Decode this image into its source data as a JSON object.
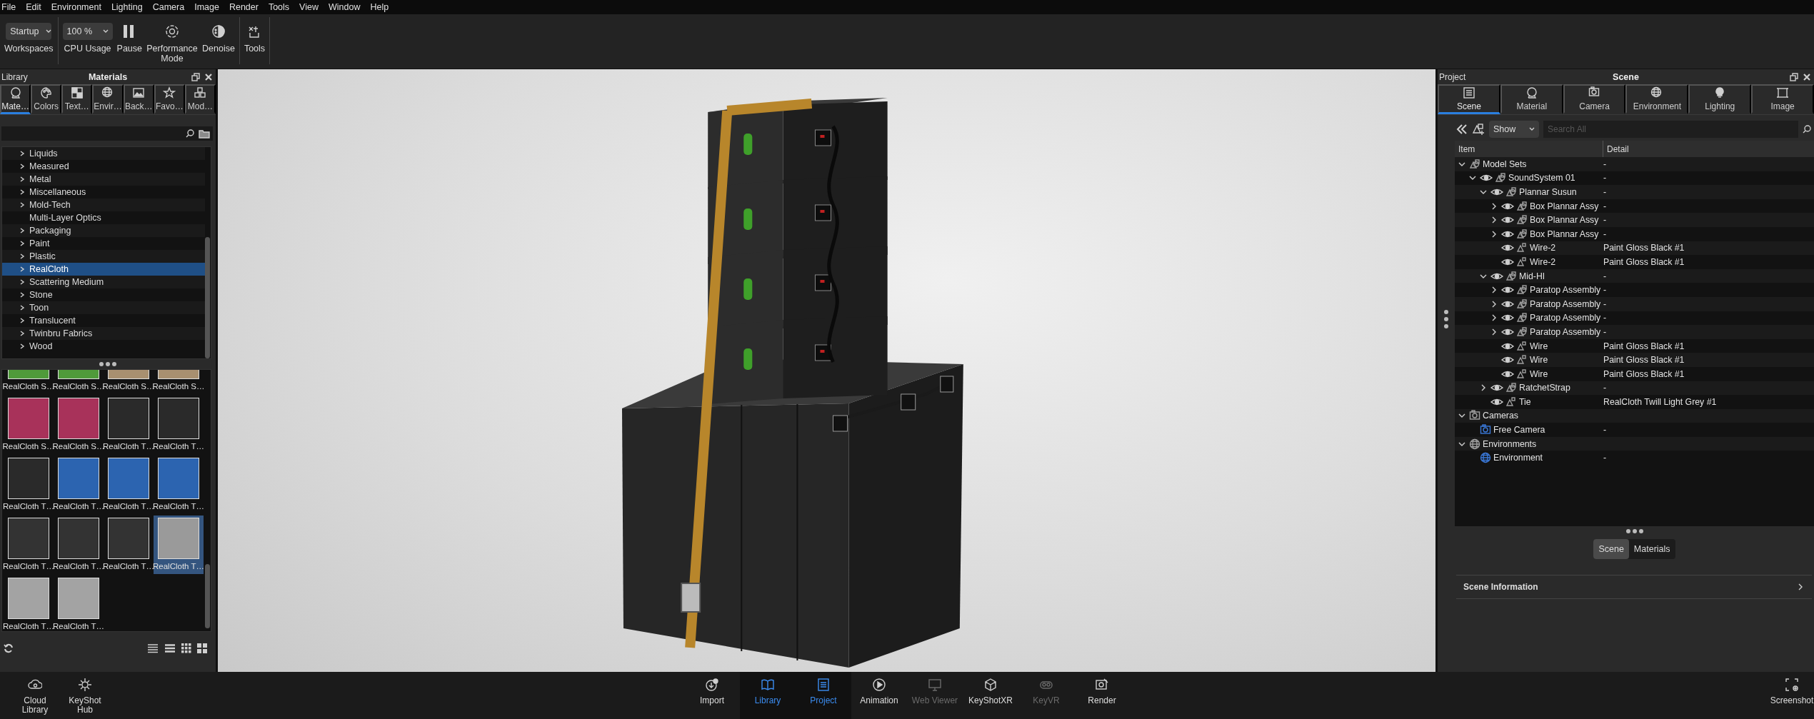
{
  "menu": [
    "File",
    "Edit",
    "Environment",
    "Lighting",
    "Camera",
    "Image",
    "Render",
    "Tools",
    "View",
    "Window",
    "Help"
  ],
  "toolbar": {
    "groups": [
      [
        {
          "kind": "dropdown",
          "value": "Startup",
          "label": "Workspaces"
        }
      ],
      [
        {
          "kind": "dropdown",
          "value": "100 %",
          "label": "CPU Usage"
        },
        {
          "kind": "button",
          "label": "Pause"
        },
        {
          "kind": "button",
          "label": "Performance Mode"
        },
        {
          "kind": "button",
          "label": "Denoise"
        }
      ],
      [
        {
          "kind": "button",
          "label": "Tools"
        }
      ]
    ]
  },
  "library": {
    "title": "Library",
    "heading": "Materials",
    "tabs": [
      {
        "label": "Mate…",
        "selected": true
      },
      {
        "label": "Colors",
        "selected": false
      },
      {
        "label": "Text…",
        "selected": false
      },
      {
        "label": "Envir…",
        "selected": false
      },
      {
        "label": "Back…",
        "selected": false
      },
      {
        "label": "Favo…",
        "selected": false
      },
      {
        "label": "Mod…",
        "selected": false
      }
    ],
    "categories": [
      {
        "label": "Liquids",
        "kind": "folder",
        "selected": false
      },
      {
        "label": "Measured",
        "kind": "folder",
        "selected": false
      },
      {
        "label": "Metal",
        "kind": "folder",
        "selected": false
      },
      {
        "label": "Miscellaneous",
        "kind": "folder",
        "selected": false
      },
      {
        "label": "Mold-Tech",
        "kind": "folder",
        "selected": false
      },
      {
        "label": "Multi-Layer Optics",
        "kind": "leaf",
        "selected": false
      },
      {
        "label": "Packaging",
        "kind": "folder",
        "selected": false
      },
      {
        "label": "Paint",
        "kind": "folder",
        "selected": false
      },
      {
        "label": "Plastic",
        "kind": "folder",
        "selected": false
      },
      {
        "label": "RealCloth",
        "kind": "folder",
        "selected": true
      },
      {
        "label": "Scattering Medium",
        "kind": "folder",
        "selected": false
      },
      {
        "label": "Stone",
        "kind": "folder",
        "selected": false
      },
      {
        "label": "Toon",
        "kind": "folder",
        "selected": false
      },
      {
        "label": "Translucent",
        "kind": "folder",
        "selected": false
      },
      {
        "label": "Twinbru Fabrics",
        "kind": "folder",
        "selected": false
      },
      {
        "label": "Wood",
        "kind": "folder",
        "selected": false
      }
    ],
    "thumbnails": [
      {
        "label": "RealCloth S…",
        "color": "#4f9a3a",
        "selected": false
      },
      {
        "label": "RealCloth S…",
        "color": "#4f9a3a",
        "selected": false
      },
      {
        "label": "RealCloth S…",
        "color": "#a89070",
        "selected": false
      },
      {
        "label": "RealCloth S…",
        "color": "#a89070",
        "selected": false
      },
      {
        "label": "RealCloth S…",
        "color": "#a8325a",
        "selected": false
      },
      {
        "label": "RealCloth S…",
        "color": "#a8325a",
        "selected": false
      },
      {
        "label": "RealCloth T…",
        "color": "#2a2a2a",
        "selected": false
      },
      {
        "label": "RealCloth T…",
        "color": "#2a2a2a",
        "selected": false
      },
      {
        "label": "RealCloth T…",
        "color": "#2a2a2a",
        "selected": false
      },
      {
        "label": "RealCloth T…",
        "color": "#2c64b0",
        "selected": false
      },
      {
        "label": "RealCloth T…",
        "color": "#2c64b0",
        "selected": false
      },
      {
        "label": "RealCloth T…",
        "color": "#2c64b0",
        "selected": false
      },
      {
        "label": "RealCloth T…",
        "color": "#333333",
        "selected": false
      },
      {
        "label": "RealCloth T…",
        "color": "#333333",
        "selected": false
      },
      {
        "label": "RealCloth T…",
        "color": "#333333",
        "selected": false
      },
      {
        "label": "RealCloth T…",
        "color": "#9a9a9a",
        "selected": true
      },
      {
        "label": "RealCloth T…",
        "color": "#a3a3a3",
        "selected": false
      },
      {
        "label": "RealCloth T…",
        "color": "#a3a3a3",
        "selected": false
      }
    ]
  },
  "project": {
    "title": "Project",
    "heading": "Scene",
    "tabs": [
      {
        "label": "Scene",
        "selected": true
      },
      {
        "label": "Material",
        "selected": false
      },
      {
        "label": "Camera",
        "selected": false
      },
      {
        "label": "Environment",
        "selected": false
      },
      {
        "label": "Lighting",
        "selected": false
      },
      {
        "label": "Image",
        "selected": false
      }
    ],
    "filter": {
      "value": "Show"
    },
    "search": {
      "placeholder": "Search All"
    },
    "columns": [
      "Item",
      "Detail"
    ],
    "tree": [
      {
        "item": "Model Sets",
        "detail": "-",
        "kind": "set",
        "expanded": true,
        "children": [
          {
            "item": "SoundSystem 01",
            "detail": "-",
            "kind": "model",
            "visible": true,
            "expanded": true,
            "children": [
              {
                "item": "Plannar Susun",
                "detail": "-",
                "kind": "model",
                "visible": true,
                "expanded": true,
                "children": [
                  {
                    "item": "Box Plannar Assy",
                    "detail": "-",
                    "kind": "model",
                    "visible": true,
                    "expanded": false
                  },
                  {
                    "item": "Box Plannar Assy",
                    "detail": "-",
                    "kind": "model",
                    "visible": true,
                    "expanded": false
                  },
                  {
                    "item": "Box Plannar Assy",
                    "detail": "-",
                    "kind": "model",
                    "visible": true,
                    "expanded": false
                  },
                  {
                    "item": "Wire-2",
                    "detail": "Paint Gloss Black #1",
                    "kind": "part",
                    "visible": true
                  },
                  {
                    "item": "Wire-2",
                    "detail": "Paint Gloss Black #1",
                    "kind": "part",
                    "visible": true
                  }
                ]
              },
              {
                "item": "Mid-HI",
                "detail": "-",
                "kind": "model",
                "visible": true,
                "expanded": true,
                "children": [
                  {
                    "item": "Paratop Assembly",
                    "detail": "-",
                    "kind": "model",
                    "visible": true,
                    "expanded": false
                  },
                  {
                    "item": "Paratop Assembly",
                    "detail": "-",
                    "kind": "model",
                    "visible": true,
                    "expanded": false
                  },
                  {
                    "item": "Paratop Assembly",
                    "detail": "-",
                    "kind": "model",
                    "visible": true,
                    "expanded": false
                  },
                  {
                    "item": "Paratop Assembly",
                    "detail": "-",
                    "kind": "model",
                    "visible": true,
                    "expanded": false
                  },
                  {
                    "item": "Wire",
                    "detail": "Paint Gloss Black #1",
                    "kind": "part",
                    "visible": true
                  },
                  {
                    "item": "Wire",
                    "detail": "Paint Gloss Black #1",
                    "kind": "part",
                    "visible": true
                  },
                  {
                    "item": "Wire",
                    "detail": "Paint Gloss Black #1",
                    "kind": "part",
                    "visible": true
                  }
                ]
              },
              {
                "item": "RatchetStrap",
                "detail": "-",
                "kind": "model",
                "visible": true,
                "expanded": false
              },
              {
                "item": "Tie",
                "detail": "RealCloth Twill Light Grey #1",
                "kind": "part",
                "visible": true
              }
            ]
          }
        ]
      },
      {
        "item": "Cameras",
        "kind": "cameras",
        "expanded": true,
        "children": [
          {
            "item": "Free Camera",
            "detail": "-",
            "kind": "camera"
          }
        ]
      },
      {
        "item": "Environments",
        "kind": "environments",
        "expanded": true,
        "children": [
          {
            "item": "Environment",
            "detail": "-",
            "kind": "environment"
          }
        ]
      }
    ],
    "view_toggle": [
      {
        "label": "Scene",
        "selected": true
      },
      {
        "label": "Materials",
        "selected": false
      }
    ],
    "section": {
      "label": "Scene Information",
      "expanded": false
    }
  },
  "bottom_bar": {
    "left": [
      {
        "label": "Cloud Library"
      },
      {
        "label": "KeyShot Hub"
      }
    ],
    "center": [
      {
        "label": "Import",
        "selected": false,
        "disabled": false
      },
      {
        "label": "Library",
        "selected": true,
        "disabled": false
      },
      {
        "label": "Project",
        "selected": true,
        "disabled": false
      },
      {
        "label": "Animation",
        "selected": false,
        "disabled": false
      },
      {
        "label": "Web Viewer",
        "selected": false,
        "disabled": true
      },
      {
        "label": "KeyShotXR",
        "selected": false,
        "disabled": false
      },
      {
        "label": "KeyVR",
        "selected": false,
        "disabled": true
      },
      {
        "label": "Render",
        "selected": false,
        "disabled": false
      }
    ],
    "right": [
      {
        "label": "Screenshot"
      }
    ]
  }
}
